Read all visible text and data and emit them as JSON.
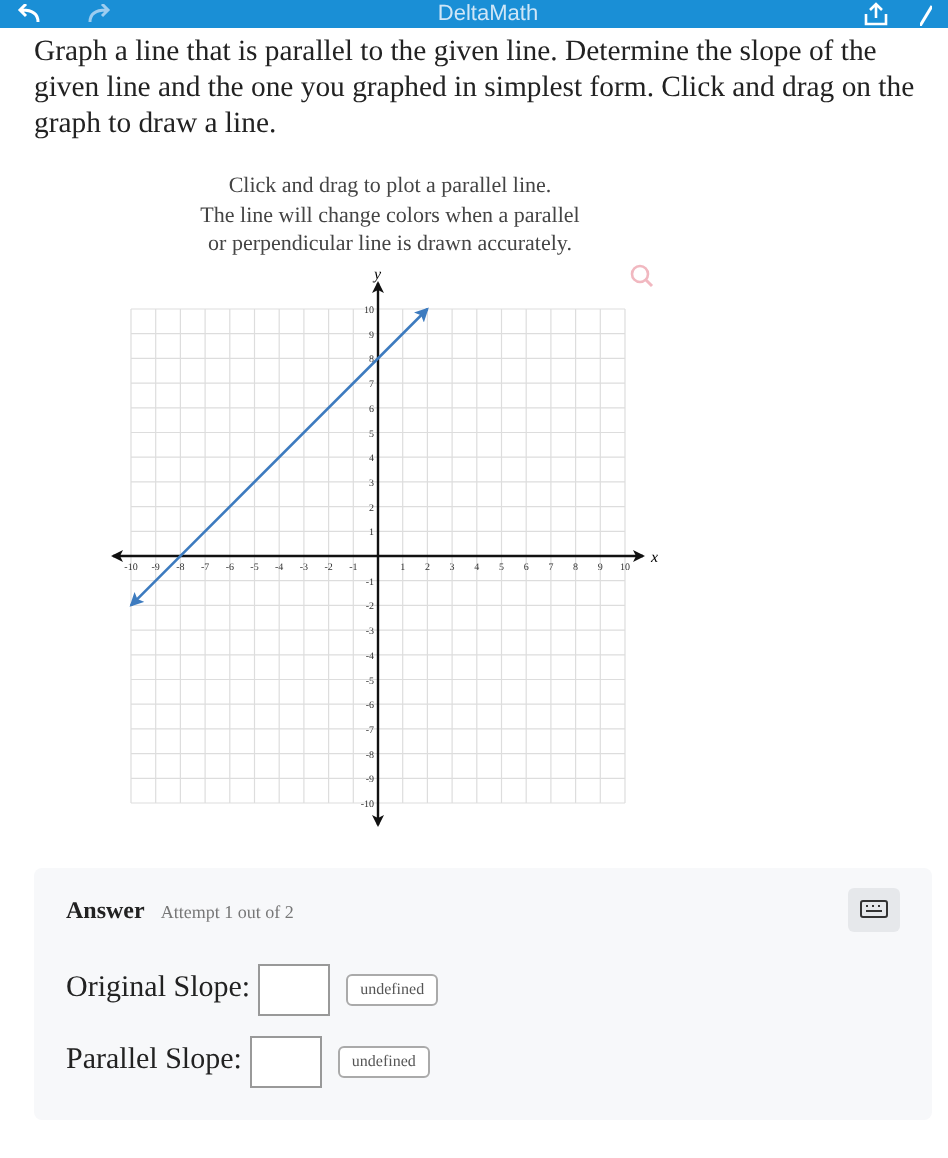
{
  "top_bar": {
    "title": "DeltaMath"
  },
  "question": "Graph a line that is parallel to the given line. Determine the slope of the given line and the one you graphed in simplest form. Click and drag on the graph to draw a line.",
  "instructions": [
    "Click and drag to plot a parallel line.",
    "The line will change colors when a parallel",
    "or perpendicular line is drawn accurately."
  ],
  "graph": {
    "chart_data": {
      "type": "line",
      "xlabel": "x",
      "ylabel": "y",
      "x": [
        -10,
        2
      ],
      "series": [
        {
          "color": "#3d7bbf",
          "values": [
            -2,
            10
          ]
        }
      ],
      "grid": true,
      "xlim": [
        -10,
        10
      ],
      "ylim": [
        -10,
        10
      ],
      "xticks": [
        -10,
        -9,
        -8,
        -7,
        -6,
        -5,
        -4,
        -3,
        -2,
        -1,
        1,
        2,
        3,
        4,
        5,
        6,
        7,
        8,
        9,
        10
      ],
      "yticks": [
        -10,
        -9,
        -8,
        -7,
        -6,
        -5,
        -4,
        -3,
        -2,
        -1,
        1,
        2,
        3,
        4,
        5,
        6,
        7,
        8,
        9,
        10
      ]
    }
  },
  "answer": {
    "title": "Answer",
    "attempt": "Attempt 1 out of 2",
    "rows": [
      {
        "label": "Original Slope:",
        "value": "",
        "button": "undefined"
      },
      {
        "label": "Parallel Slope:",
        "value": "",
        "button": "undefined"
      }
    ]
  }
}
